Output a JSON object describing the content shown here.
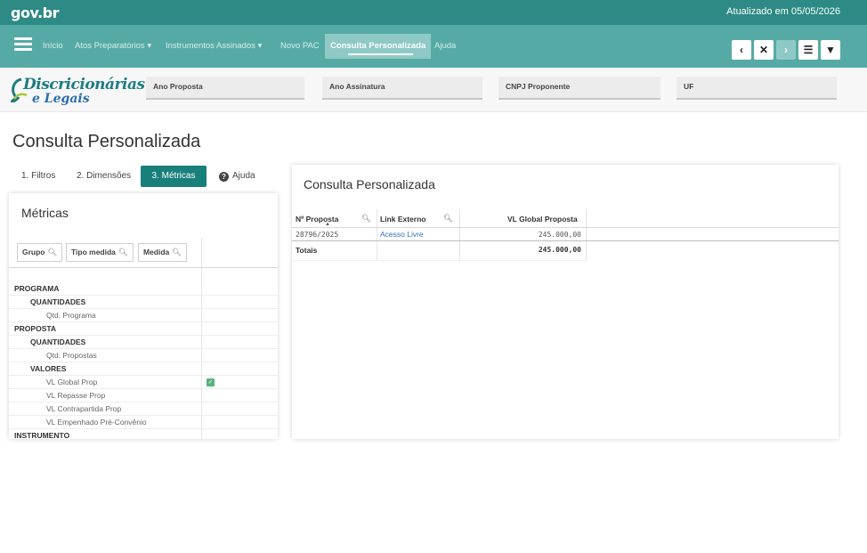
{
  "top": {
    "logo": "gov.br",
    "updated": "Atualizado em 05/05/2026"
  },
  "nav": {
    "items": [
      "Início",
      "Atos Preparatórios ▾",
      "Instrumentos Assinados ▾",
      "Novo PAC",
      "Consulta Personalizada",
      "Ajuda"
    ],
    "active": "Consulta Personalizada",
    "tools": {
      "back": "‹",
      "clear": "✕",
      "forward": "›",
      "selections": "☰",
      "filter": "▼"
    }
  },
  "brand": {
    "line1": "Discricionárias",
    "line2": "e Legais"
  },
  "filters": [
    "Ano Proposta",
    "Ano Assinatura",
    "CNPJ Proponente",
    "UF"
  ],
  "page": {
    "title": "Consulta Personalizada"
  },
  "tabs": [
    "1. Filtros",
    "2. Dimensões",
    "3. Métricas",
    "Ajuda"
  ],
  "metrics": {
    "title": "Métricas",
    "headers": [
      "Grupo",
      "Tipo medida",
      "Medida"
    ],
    "rows": [
      {
        "label": "PROGRAMA",
        "level": 0
      },
      {
        "label": "QUANTIDADES",
        "level": 1
      },
      {
        "label": "Qtd. Programa",
        "level": 2
      },
      {
        "label": "PROPOSTA",
        "level": 0
      },
      {
        "label": "QUANTIDADES",
        "level": 1
      },
      {
        "label": "Qtd. Propostas",
        "level": 2
      },
      {
        "label": "VALORES",
        "level": 1
      },
      {
        "label": "VL Global Prop",
        "level": 2,
        "checked": true
      },
      {
        "label": "VL Repasse Prop",
        "level": 2
      },
      {
        "label": "VL Contrapartida Prop",
        "level": 2
      },
      {
        "label": "VL Empenhado Pré-Convênio",
        "level": 2
      },
      {
        "label": "INSTRUMENTO",
        "level": 0
      }
    ]
  },
  "results": {
    "title": "Consulta Personalizada",
    "columns": [
      "Nº Proposta",
      "Link Externo",
      "VL Global Proposta"
    ],
    "row": {
      "proposta": "28796/2025",
      "link": "Acesso Livre",
      "valor": "245.000,00"
    },
    "totals": {
      "label": "Totais",
      "valor": "245.000,00"
    }
  },
  "colors": {
    "topbar": "#2d8a84",
    "navbar": "#56aaa5",
    "active_tab": "#187f7a",
    "link": "#3572b5"
  }
}
